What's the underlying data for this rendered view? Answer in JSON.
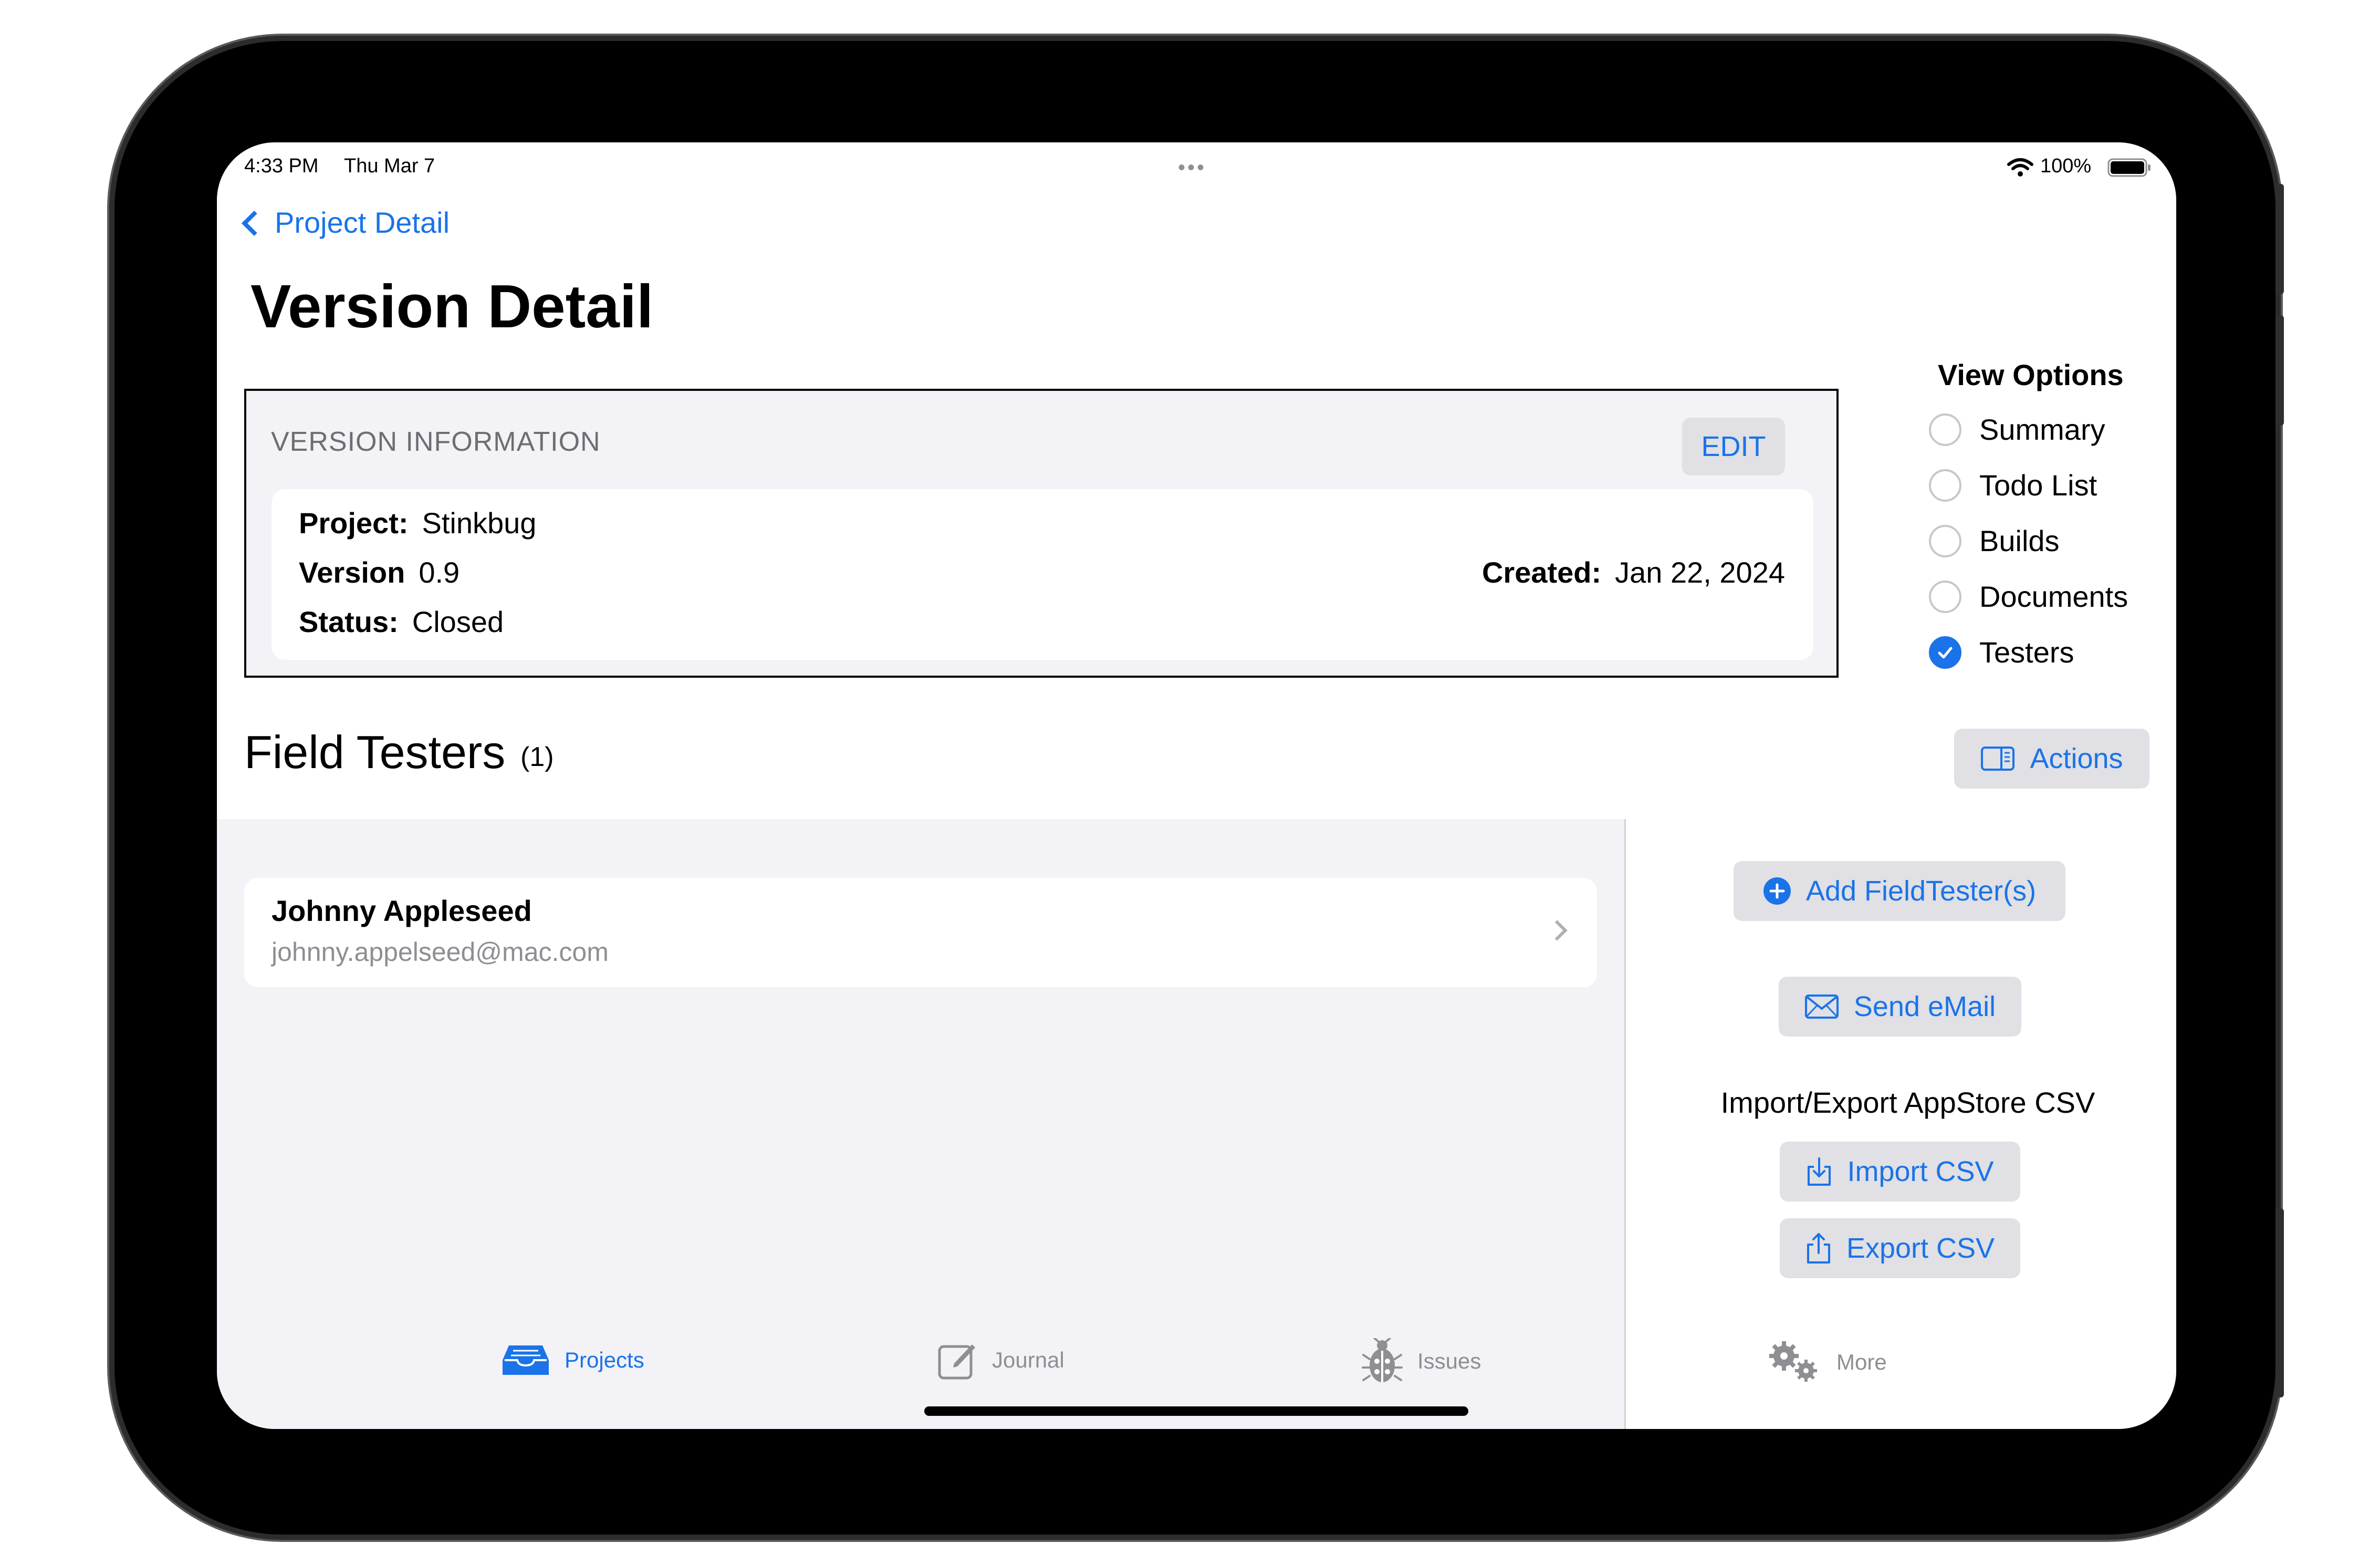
{
  "status_bar": {
    "time": "4:33 PM",
    "date": "Thu Mar 7",
    "dots": "•••",
    "battery": "100%"
  },
  "nav": {
    "back_label": "Project Detail",
    "title": "Version Detail"
  },
  "version_info": {
    "header": "VERSION INFORMATION",
    "edit_label": "EDIT",
    "project_label": "Project:",
    "project_value": "Stinkbug",
    "version_label": "Version",
    "version_value": "0.9",
    "status_label": "Status:",
    "status_value": "Closed",
    "created_label": "Created:",
    "created_value": "Jan 22, 2024"
  },
  "view_options": {
    "title": "View Options",
    "items": [
      {
        "label": "Summary",
        "checked": false
      },
      {
        "label": "Todo List",
        "checked": false
      },
      {
        "label": "Builds",
        "checked": false
      },
      {
        "label": "Documents",
        "checked": false
      },
      {
        "label": "Testers",
        "checked": true
      }
    ]
  },
  "section": {
    "title": "Field Testers",
    "count": "(1)",
    "actions_label": "Actions"
  },
  "testers": [
    {
      "name": "Johnny Appleseed",
      "email": "johnny.appelseed@mac.com"
    }
  ],
  "sidebar_actions": {
    "add_label": "Add FieldTester(s)",
    "email_label": "Send eMail",
    "csv_label": "Import/Export AppStore CSV",
    "import_label": "Import CSV",
    "export_label": "Export CSV"
  },
  "tabs": [
    {
      "label": "Projects",
      "icon": "tray-icon",
      "active": true
    },
    {
      "label": "Journal",
      "icon": "compose-icon",
      "active": false
    },
    {
      "label": "Issues",
      "icon": "ladybug-icon",
      "active": false
    },
    {
      "label": "More",
      "icon": "gears-icon",
      "active": false
    }
  ],
  "colors": {
    "accent": "#1a73e8",
    "grouped_bg": "#f2f2f7",
    "button_bg": "#e0e0e5",
    "secondary_text": "#8e8e93"
  }
}
